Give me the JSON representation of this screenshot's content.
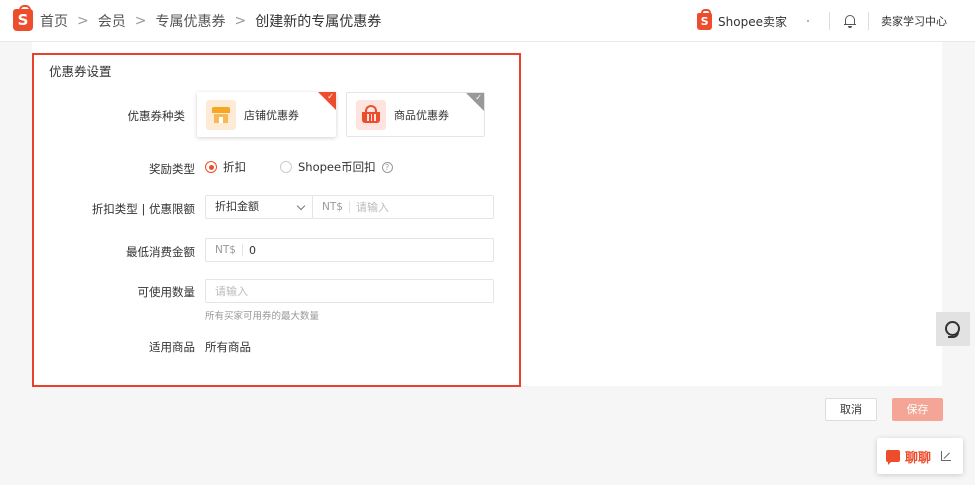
{
  "header": {
    "logo_letter": "S",
    "breadcrumbs": [
      "首页",
      "会员",
      "专属优惠券",
      "创建新的专属优惠券"
    ],
    "separator": ">",
    "brand_text": "Shopee卖家",
    "learning_center": "卖家学习中心"
  },
  "form": {
    "section_title": "优惠券设置",
    "coupon_type_label": "优惠券种类",
    "coupon_types": [
      {
        "label": "店铺优惠券",
        "selected": true
      },
      {
        "label": "商品优惠券",
        "selected": false
      }
    ],
    "reward_type_label": "奖励类型",
    "reward_options": [
      "折扣",
      "Shopee币回扣"
    ],
    "reward_selected": "折扣",
    "reward_help_icon": "?",
    "discount_label": "折扣类型 | 优惠限额",
    "discount_select_value": "折扣金额",
    "currency_prefix": "NT$",
    "discount_amount_placeholder": "请输入",
    "min_spend_label": "最低消费金额",
    "min_spend_value": "0",
    "usage_qty_label": "可使用数量",
    "usage_qty_placeholder": "请输入",
    "usage_qty_hint": "所有买家可用券的最大数量",
    "applicable_products_label": "适用商品",
    "applicable_products_value": "所有商品"
  },
  "actions": {
    "cancel": "取消",
    "save": "保存"
  },
  "chat": {
    "label": "聊聊"
  },
  "colors": {
    "brand": "#ee4d2d",
    "save_disabled": "#f4a595"
  }
}
